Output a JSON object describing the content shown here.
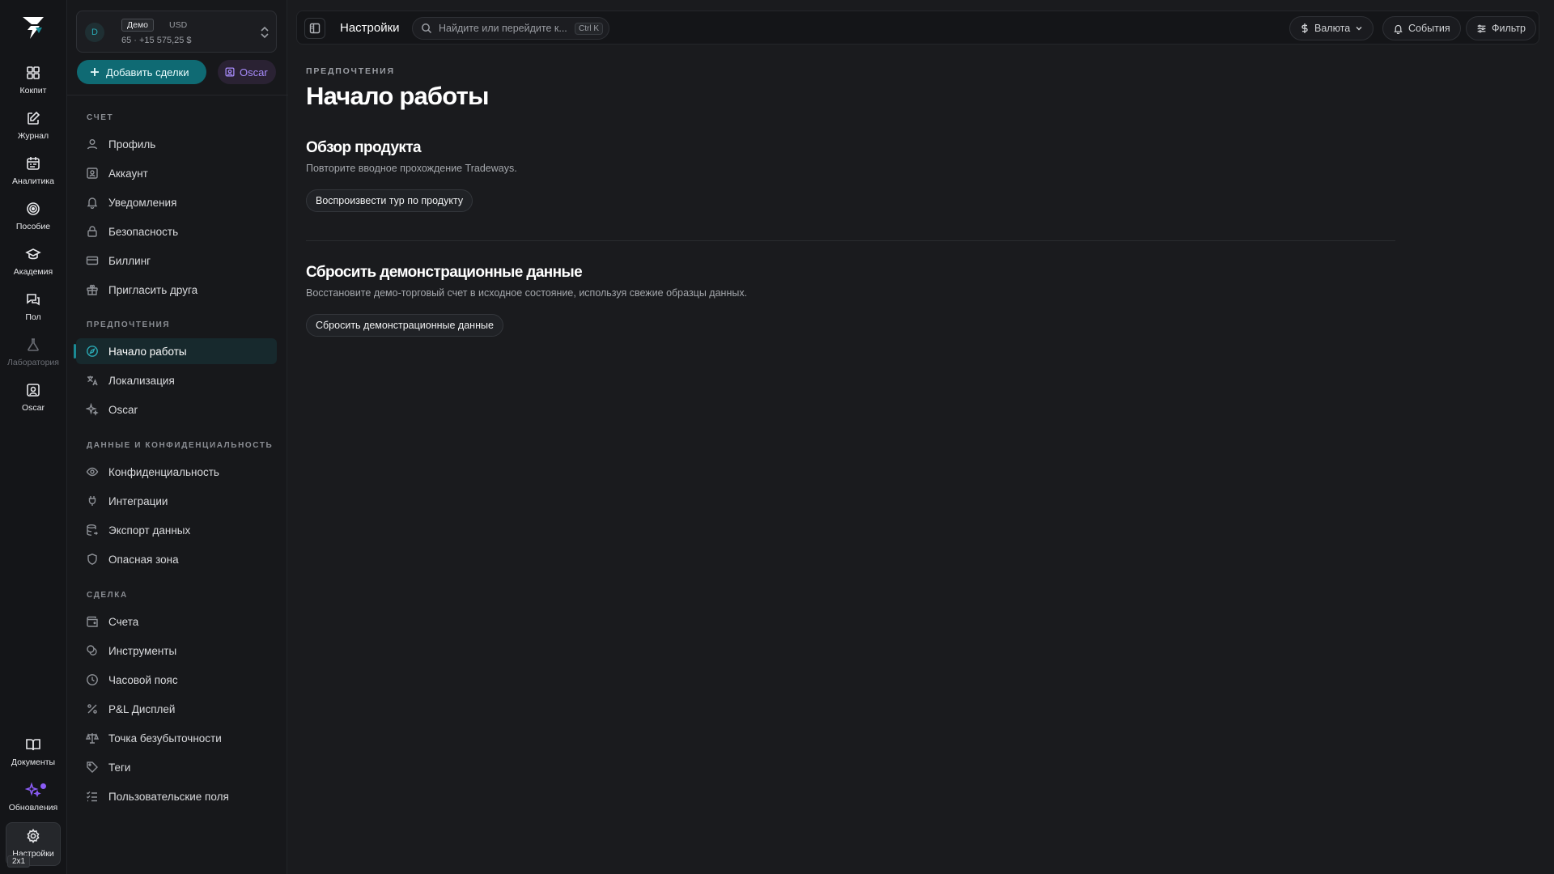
{
  "rail": {
    "items": [
      {
        "label": "Кокпит",
        "icon": "dashboard-icon"
      },
      {
        "label": "Журнал",
        "icon": "journal-edit-icon"
      },
      {
        "label": "Аналитика",
        "icon": "calendar-analytics-icon"
      },
      {
        "label": "Пособие",
        "icon": "target-icon"
      },
      {
        "label": "Академия",
        "icon": "graduation-cap-icon"
      },
      {
        "label": "Пол",
        "icon": "chat-bubbles-icon"
      },
      {
        "label": "Лаборатория",
        "icon": "flask-icon"
      },
      {
        "label": "Oscar",
        "icon": "oscar-portrait-icon"
      }
    ],
    "bottom": [
      {
        "label": "Документы",
        "icon": "book-icon"
      },
      {
        "label": "Обновления",
        "icon": "sparkles-icon"
      },
      {
        "label": "Настройки",
        "icon": "gear-icon"
      }
    ],
    "zoom_badge": "2x1"
  },
  "account": {
    "avatar_letter": "D",
    "mode": "Демо",
    "currency": "USD",
    "balance": "65 · +15 575,25 $"
  },
  "actions": {
    "add_trades": "Добавить сделки",
    "oscar": "Oscar"
  },
  "sidebar": {
    "sections": [
      {
        "title": "Счет",
        "items": [
          {
            "label": "Профиль",
            "icon": "user-icon"
          },
          {
            "label": "Аккаунт",
            "icon": "id-card-icon"
          },
          {
            "label": "Уведомления",
            "icon": "bell-icon"
          },
          {
            "label": "Безопасность",
            "icon": "lock-icon"
          },
          {
            "label": "Биллинг",
            "icon": "credit-card-icon"
          },
          {
            "label": "Пригласить друга",
            "icon": "gift-icon"
          }
        ]
      },
      {
        "title": "Предпочтения",
        "items": [
          {
            "label": "Начало работы",
            "icon": "compass-icon",
            "active": true
          },
          {
            "label": "Локализация",
            "icon": "translate-icon"
          },
          {
            "label": "Oscar",
            "icon": "sparkle-icon"
          }
        ]
      },
      {
        "title": "Данные и конфиденциальность",
        "items": [
          {
            "label": "Конфиденциальность",
            "icon": "eye-icon"
          },
          {
            "label": "Интеграции",
            "icon": "plug-icon"
          },
          {
            "label": "Экспорт данных",
            "icon": "database-export-icon"
          },
          {
            "label": "Опасная зона",
            "icon": "shield-icon"
          }
        ]
      },
      {
        "title": "Сделка",
        "items": [
          {
            "label": "Счета",
            "icon": "wallet-icon"
          },
          {
            "label": "Инструменты",
            "icon": "coins-icon"
          },
          {
            "label": "Часовой пояс",
            "icon": "clock-icon"
          },
          {
            "label": "P&L Дисплей",
            "icon": "percent-icon"
          },
          {
            "label": "Точка безубыточности",
            "icon": "scale-icon"
          },
          {
            "label": "Теги",
            "icon": "tag-icon"
          },
          {
            "label": "Пользовательские поля",
            "icon": "checklist-icon"
          }
        ]
      }
    ]
  },
  "topbar": {
    "title": "Настройки",
    "search_placeholder": "Найдите или перейдите к...",
    "search_shortcut": "Ctrl K",
    "currency_btn": "Валюта",
    "events_btn": "События",
    "filter_btn": "Фильтр"
  },
  "main": {
    "breadcrumb": "ПРЕДПОЧТЕНИЯ",
    "title": "Начало работы",
    "blocks": [
      {
        "title": "Обзор продукта",
        "description": "Повторите вводное прохождение Tradeways.",
        "button": "Воспроизвести тур по продукту"
      },
      {
        "title": "Сбросить демонстрационные данные",
        "description": "Восстановите демо-торговый счет в исходное состояние, используя свежие образцы данных.",
        "button": "Сбросить демонстрационные данные"
      }
    ]
  },
  "colors": {
    "background": "#1a1b1e",
    "rail": "#141518",
    "accent": "#0f6a73",
    "accent_text": "#2aa8b3",
    "oscar": "#a78bfa"
  }
}
